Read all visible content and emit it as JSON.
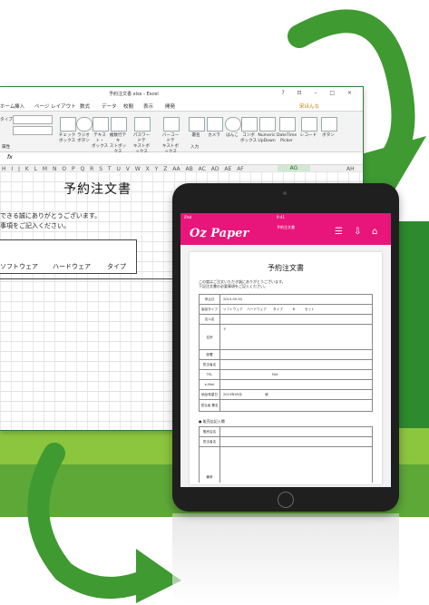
{
  "colors": {
    "green_dark": "#2e8a2e",
    "green_light": "#8cc63f",
    "green_band": "#6fb43f",
    "pink": "#e8157a"
  },
  "excel": {
    "window_title": "予約注文書.xlsx - Excel",
    "window_controls": "? ⊡ – □ ×",
    "user": "宋ほんな",
    "tabs": [
      "ホーム",
      "挿入",
      "ページ レイアウト",
      "数式",
      "データ",
      "校閲",
      "表示",
      "開発"
    ],
    "ribbon_left": "タイプ",
    "ribbon_items": [
      "チェック\nボックス",
      "ラジオ\nボタン",
      "テキスト・\nボックス",
      "複数行テキ\nストボックス",
      "パスワードテ\nキストボックス",
      "バーコードテ\nキストボックス",
      "署名",
      "カメラ",
      "はんこ",
      "コンボ\nボックス",
      "Numeric\nUpDown",
      "DateTime\nPicker",
      "レコード",
      "ボタン"
    ],
    "ribbon_group_left": "属性",
    "ribbon_group_input": "入力",
    "fx": "fx",
    "columns": "H I J K L M N O P Q R S T U V W X Y Z AA AB AC AD AE AF",
    "active_col": "AG",
    "last_col": "AH",
    "sheet_title": "予約注文書",
    "msg1": "できる誠にありがとうございます。",
    "msg2": "事項をご記入ください。",
    "table_headers": [
      "ソフトウェア",
      "ハードウェア",
      "タイプ"
    ]
  },
  "ipad": {
    "statusbar_left": "iPad",
    "statusbar_time": "9:41",
    "app_logo": "Oz Paper",
    "app_title": "予約注文書",
    "icons": [
      "list-icon",
      "download-icon",
      "home-icon"
    ],
    "doc": {
      "title": "予約注文書",
      "msg1": "この度はご注文いただき誠にありがとうございます。",
      "msg2": "下記注文書の必要事項をご記入ください。",
      "rows": [
        {
          "label": "申込日",
          "value": "2015-09-30"
        },
        {
          "label": "製品タイプ",
          "value": "ソフトウェア　 ハードウェア　　タイプ　　　B　　　セット"
        },
        {
          "label": "法人名",
          "value": ""
        },
        {
          "label": "住所",
          "value": "〒"
        },
        {
          "label": "部署",
          "value": ""
        },
        {
          "label": "担当者名",
          "value": ""
        },
        {
          "label": "TEL",
          "value": "　　　　　　　　　　　　　　　FAX"
        },
        {
          "label": "e-Mail",
          "value": ""
        },
        {
          "label": "納品希望日",
          "value": "2015年09月　　　　　　　頃"
        },
        {
          "label": "担当者 署名",
          "value": ""
        }
      ],
      "section2": "● 販売店記入欄",
      "rows2": [
        {
          "label": "販売店名",
          "value": ""
        },
        {
          "label": "担当者名",
          "value": ""
        },
        {
          "label": "備考",
          "value": ""
        }
      ]
    }
  }
}
